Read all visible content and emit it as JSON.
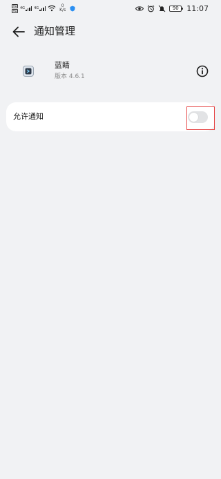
{
  "status_bar": {
    "sim1_label": "HD",
    "sim2_label": "HD",
    "signal1": "4G",
    "signal2": "4G",
    "net_speed_value": "0",
    "net_speed_unit": "K/s",
    "battery": "90",
    "time": "11:07",
    "icons": [
      "sim-card-icon",
      "signal-bars-icon",
      "wifi-icon",
      "shield-icon",
      "eye-icon",
      "alarm-icon",
      "mute-bell-icon",
      "battery-icon"
    ]
  },
  "header": {
    "back_icon": "arrow-left-icon",
    "title": "通知管理"
  },
  "app": {
    "name": "蓝睛",
    "version": "版本 4.6.1",
    "info_icon": "info-circle-icon"
  },
  "settings": {
    "allow_notifications_label": "允许通知",
    "allow_notifications_enabled": false
  },
  "colors": {
    "background": "#f1f2f4",
    "card": "#ffffff",
    "highlight_border": "#e64545",
    "toggle_off": "#e2e3e5"
  }
}
